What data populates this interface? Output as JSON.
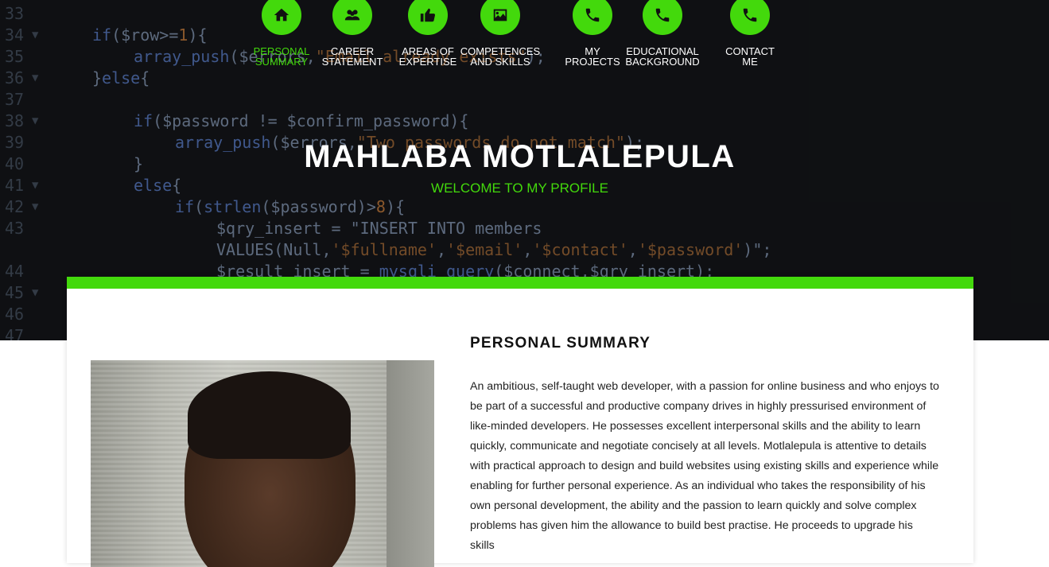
{
  "nav": {
    "items": [
      {
        "label": "PERSONAL\nSUMMARY",
        "icon": "home-icon",
        "active": true
      },
      {
        "label": "CAREER\nSTATEMENT",
        "icon": "users-icon",
        "active": false
      },
      {
        "label": "AREAS OF\nEXPERTISE",
        "icon": "thumbs-up-icon",
        "active": false
      },
      {
        "label": "COMPETENCES\nAND SKILLS",
        "icon": "image-icon",
        "active": false
      },
      {
        "label": "MY\nPROJECTS",
        "icon": "phone-icon",
        "active": false
      },
      {
        "label": "EDUCATIONAL\nBACKGROUND",
        "icon": "phone-icon",
        "active": false
      },
      {
        "label": "CONTACT\nME",
        "icon": "phone-icon",
        "active": false
      }
    ]
  },
  "hero": {
    "title": "MAHLABA MOTLALEPULA",
    "subtitle": "WELCOME TO MY PROFILE"
  },
  "code_background": [
    {
      "n": "33",
      "fold": false,
      "indent": 0,
      "text": ""
    },
    {
      "n": "34",
      "fold": true,
      "indent": 1,
      "text": "if($row>=1){"
    },
    {
      "n": "35",
      "fold": false,
      "indent": 2,
      "text": "array_push($errors,\"Email already exists\");"
    },
    {
      "n": "36",
      "fold": true,
      "indent": 1,
      "text": "}else{"
    },
    {
      "n": "37",
      "fold": false,
      "indent": 0,
      "text": ""
    },
    {
      "n": "38",
      "fold": true,
      "indent": 2,
      "text": "if($password != $confirm_password){"
    },
    {
      "n": "39",
      "fold": false,
      "indent": 3,
      "text": "array_push($errors,\"Two passwords do not match\");"
    },
    {
      "n": "40",
      "fold": false,
      "indent": 2,
      "text": "}"
    },
    {
      "n": "41",
      "fold": true,
      "indent": 2,
      "text": "else{"
    },
    {
      "n": "42",
      "fold": true,
      "indent": 3,
      "text": "if(strlen($password)>8){"
    },
    {
      "n": "43",
      "fold": false,
      "indent": 4,
      "text": "$qry_insert = \"INSERT INTO members"
    },
    {
      "n": "",
      "fold": false,
      "indent": 4,
      "text": "VALUES(Null,'$fullname','$email','$contact','$password')\";"
    },
    {
      "n": "44",
      "fold": false,
      "indent": 4,
      "text": "$result_insert = mysqli_query($connect,$qry_insert);"
    },
    {
      "n": "45",
      "fold": true,
      "indent": 0,
      "text": ""
    },
    {
      "n": "46",
      "fold": false,
      "indent": 0,
      "text": ""
    },
    {
      "n": "47",
      "fold": false,
      "indent": 0,
      "text": ""
    }
  ],
  "content": {
    "section_title": "PERSONAL SUMMARY",
    "summary": "An ambitious, self-taught web developer, with a passion for online business and who enjoys to be part of a successful and productive company drives in highly pressurised environment of like-minded developers. He possesses excellent interpersonal skills and the ability to learn quickly, communicate and negotiate concisely at all levels. Motlalepula is attentive to details with practical approach to design and build websites using existing skills and experience while enabling for further personal experience. As an individual who takes the responsibility of his own personal development, the ability and the passion to learn quickly and solve complex problems has given him the allowance to build best practise. He proceeds to upgrade his skills"
  },
  "colors": {
    "accent": "#43d90c",
    "hero_bg": "#101214",
    "text": "#222222"
  }
}
